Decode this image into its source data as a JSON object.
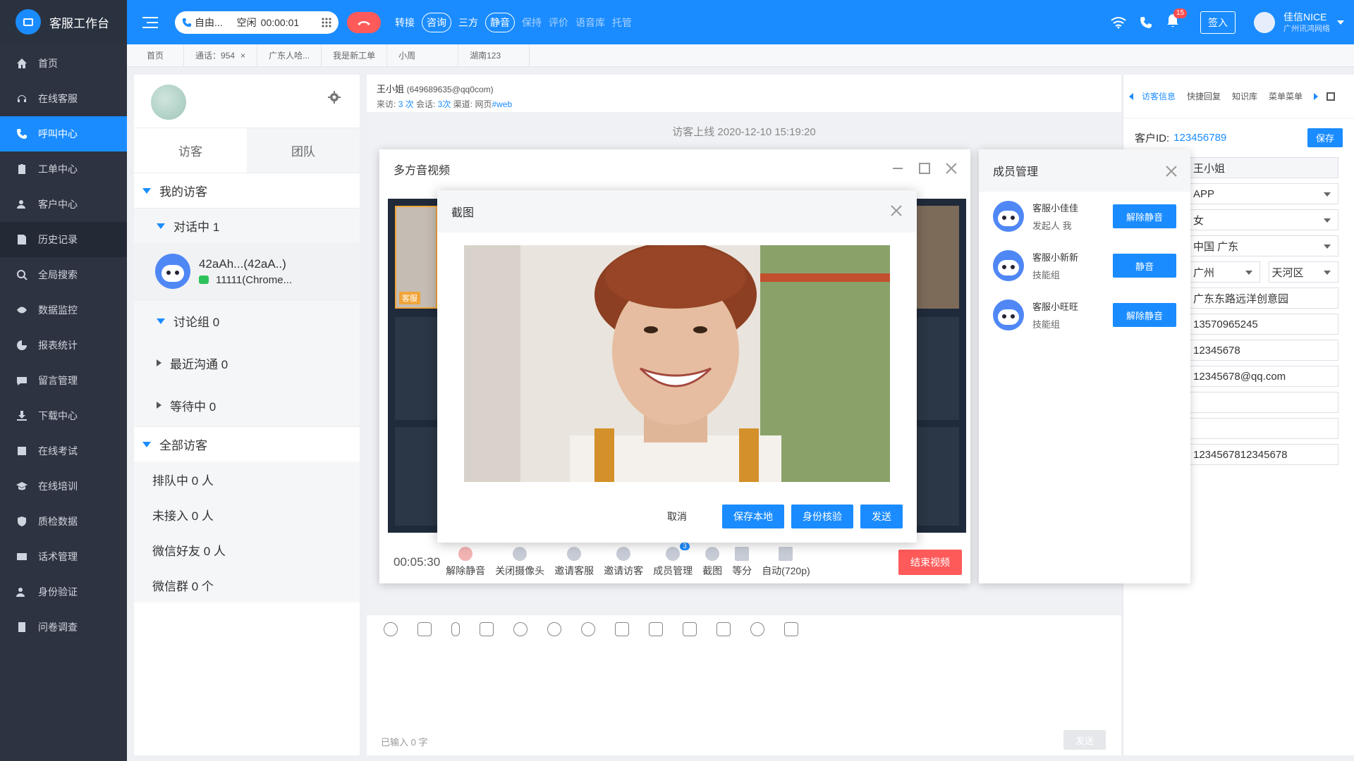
{
  "brand": {
    "title": "客服工作台"
  },
  "nav": [
    {
      "label": "首页",
      "icon": "home-icon"
    },
    {
      "label": "在线客服",
      "icon": "headset-icon"
    },
    {
      "label": "呼叫中心",
      "icon": "phone-icon"
    },
    {
      "label": "工单中心",
      "icon": "clipboard-icon"
    },
    {
      "label": "客户中心",
      "icon": "users-icon"
    },
    {
      "label": "历史记录",
      "icon": "history-icon"
    },
    {
      "label": "全局搜索",
      "icon": "search-icon"
    },
    {
      "label": "数据监控",
      "icon": "eye-icon"
    },
    {
      "label": "报表统计",
      "icon": "pie-chart-icon"
    },
    {
      "label": "留言管理",
      "icon": "message-icon"
    },
    {
      "label": "下载中心",
      "icon": "download-icon"
    },
    {
      "label": "在线考试",
      "icon": "exam-icon"
    },
    {
      "label": "在线培训",
      "icon": "graduation-icon"
    },
    {
      "label": "质检数据",
      "icon": "shield-icon"
    },
    {
      "label": "话术管理",
      "icon": "script-icon"
    },
    {
      "label": "身份验证",
      "icon": "id-user-icon"
    },
    {
      "label": "问卷调查",
      "icon": "survey-icon"
    }
  ],
  "topbar": {
    "status_text": "自由...",
    "idle_label": "空闲",
    "idle_time": "00:00:01",
    "actions": [
      "转接",
      "咨询",
      "三方",
      "静音",
      "保持",
      "评价",
      "语音库",
      "托管"
    ],
    "notification_count": "15",
    "signin": "签入",
    "user_name": "佳信NICE",
    "user_org": "广州讯鸿网络"
  },
  "tabs": [
    "首页",
    "通话：954",
    "广东人哈...",
    "我是新工单",
    "小周",
    "湖南123"
  ],
  "left": {
    "tab_visitor": "访客",
    "tab_team": "团队",
    "my_visitors": "我的访客",
    "in_chat": "对话中 1",
    "visitor_name": "42aAh...(42aA..)",
    "visitor_sub": "11111(Chrome...",
    "discussion": "讨论组 0",
    "recent": "最近沟通 0",
    "waiting": "等待中 0",
    "all_visitors": "全部访客",
    "queue": "排队中 0 人",
    "unanswered": "未接入 0 人",
    "wechat_friends": "微信好友 0 人",
    "wechat_groups": "微信群 0 个"
  },
  "chat": {
    "name": "王小姐",
    "email": "(649689635@qq0com)",
    "visits_label": "来访:",
    "visits": "3 次",
    "sessions_label": "会话:",
    "sessions": "3次",
    "channel_label": "渠道:",
    "channel": "网页",
    "channel_tag": "#web",
    "online_notice": "访客上线 2020-12-10 15:19:20",
    "input_count": "已输入 0 字",
    "send": "发送"
  },
  "video": {
    "title": "多方音视频",
    "timer": "00:05:30",
    "controls": [
      "解除静音",
      "关闭摄像头",
      "邀请客服",
      "邀请访客",
      "成员管理",
      "截图",
      "等分",
      "自动(720p)"
    ],
    "member_badge": "3",
    "end": "结束视频",
    "thumb_label": "客服"
  },
  "members": {
    "title": "成员管理",
    "list": [
      {
        "name": "客服小佳佳",
        "role": "发起人  我",
        "btn": "解除静音"
      },
      {
        "name": "客服小新新",
        "role": "技能组",
        "btn": "静音"
      },
      {
        "name": "客服小旺旺",
        "role": "技能组",
        "btn": "解除静音"
      }
    ]
  },
  "screenshot": {
    "title": "截图",
    "cancel": "取消",
    "save": "保存本地",
    "verify": "身份核验",
    "send": "发送"
  },
  "right": {
    "tabs": [
      "访客信息",
      "快捷回复",
      "知识库",
      "菜单菜单"
    ],
    "customer_id_label": "客户ID:",
    "customer_id": "123456789",
    "save": "保存",
    "fields": [
      "王小姐",
      "APP",
      "女",
      "中国    广东",
      "广州",
      "天河区",
      "广东东路远洋创意园",
      "13570965245",
      "12345678",
      "12345678@qq.com",
      "",
      "",
      "1234567812345678"
    ]
  }
}
